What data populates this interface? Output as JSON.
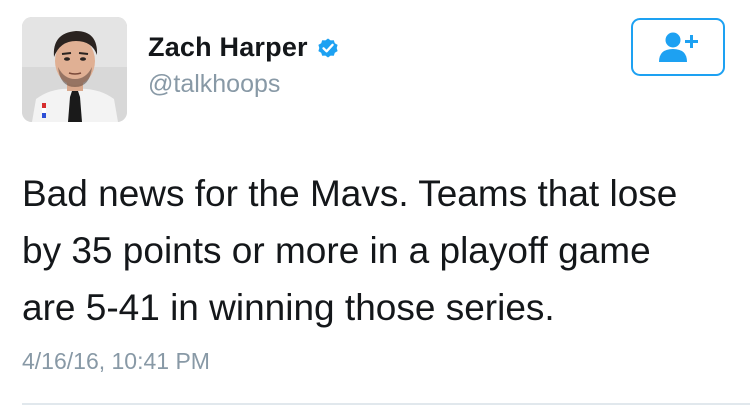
{
  "user": {
    "display_name": "Zach Harper",
    "handle": "@talkhoops",
    "verified": true,
    "avatar_icon": "profile-photo"
  },
  "follow_button": {
    "icon": "add-user-icon",
    "color": "#1da1f2"
  },
  "tweet": {
    "lines": [
      "Bad news for the Mavs. Teams that lose",
      "by 35 points or more in a playoff game",
      "are 5-41 in winning those series."
    ],
    "timestamp": "4/16/16, 10:41 PM"
  },
  "colors": {
    "text": "#14171a",
    "secondary": "#8899a6",
    "accent": "#1da1f2",
    "divider": "#e1e8ed"
  }
}
